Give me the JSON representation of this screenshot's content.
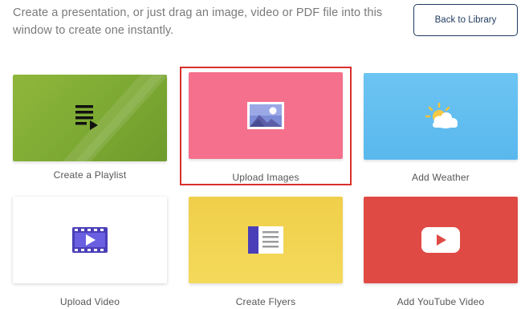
{
  "header": {
    "intro_text": "Create a presentation, or just drag an image, video or PDF file into this window to create one instantly.",
    "back_button_label": "Back to Library"
  },
  "cards": [
    {
      "label": "Create a Playlist",
      "icon": "playlist-icon",
      "color": "#7fac34"
    },
    {
      "label": "Upload Images",
      "icon": "image-icon",
      "color": "#f5708c",
      "highlighted": true
    },
    {
      "label": "Add Weather",
      "icon": "weather-icon",
      "color": "#5ab8ee"
    },
    {
      "label": "Upload Video",
      "icon": "video-icon",
      "color": "#ffffff"
    },
    {
      "label": "Create Flyers",
      "icon": "flyer-icon",
      "color": "#f2d350"
    },
    {
      "label": "Add YouTube Video",
      "icon": "youtube-icon",
      "color": "#e04a44"
    }
  ],
  "colors": {
    "accent": "#1f3a5f",
    "highlight_border": "#d9302c"
  }
}
